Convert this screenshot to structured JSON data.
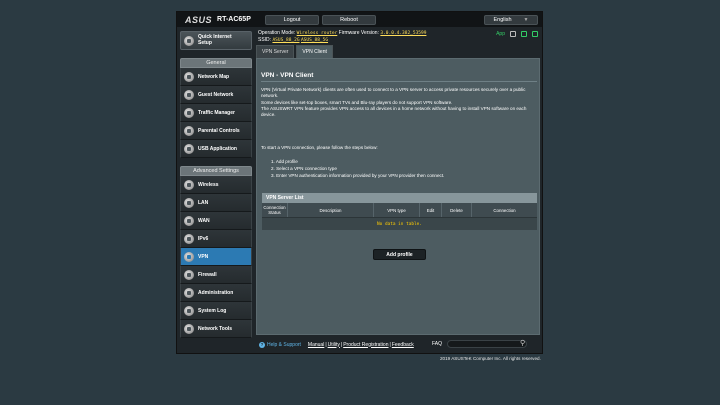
{
  "brand": {
    "logo": "ASUS",
    "model": "RT-AC65P"
  },
  "topbar": {
    "logout": "Logout",
    "reboot": "Reboot",
    "language": "English"
  },
  "header": {
    "op_mode_label": "Operation Mode:",
    "op_mode_value": "Wireless router",
    "firmware_label": "Firmware Version:",
    "firmware_value": "3.0.0.4.382_53599",
    "ssid_label": "SSID:",
    "ssid_1": "ASUS_88_2G",
    "ssid_2": "ASUS_88_5G",
    "app_label": "App"
  },
  "sidebar": {
    "quick_setup": "Quick Internet Setup",
    "general_header": "General",
    "general_items": [
      "Network Map",
      "Guest Network",
      "Traffic Manager",
      "Parental Controls",
      "USB Application"
    ],
    "advanced_header": "Advanced Settings",
    "advanced_items": [
      "Wireless",
      "LAN",
      "WAN",
      "IPv6",
      "VPN",
      "Firewall",
      "Administration",
      "System Log",
      "Network Tools"
    ],
    "active_item": "VPN"
  },
  "tabs": [
    "VPN Server",
    "VPN Client"
  ],
  "active_tab": "VPN Client",
  "main": {
    "title": "VPN - VPN Client",
    "desc_1": "VPN (Virtual Private Network) clients are often used to connect to a VPN server to access private resources securely over a public network.",
    "desc_2": "Some devices like set-top boxes, smart TVs and Blu-ray players do not support VPN software.",
    "desc_3": "The ASUSWRT VPN feature provides VPN access to all devices in a home network without having to install VPN software on each device.",
    "steps_intro": "To start a VPN connection, please follow the steps below:",
    "steps": [
      "1. Add profile",
      "2. Select a VPN connection type",
      "3. Enter VPN authentication information provided by your VPN provider then connect."
    ],
    "table_title": "VPN Server List",
    "columns": [
      "Connection Status",
      "Description",
      "VPN type",
      "Edit",
      "Delete",
      "Connection"
    ],
    "no_data": "No data in table.",
    "add_profile": "Add profile"
  },
  "footer": {
    "help_support": "Help & Support",
    "links": [
      "Manual",
      "Utility",
      "Product Registration",
      "Feedback"
    ],
    "faq": "FAQ",
    "copyright": "2019 ASUSTeK Computer Inc. All rights reserved."
  }
}
